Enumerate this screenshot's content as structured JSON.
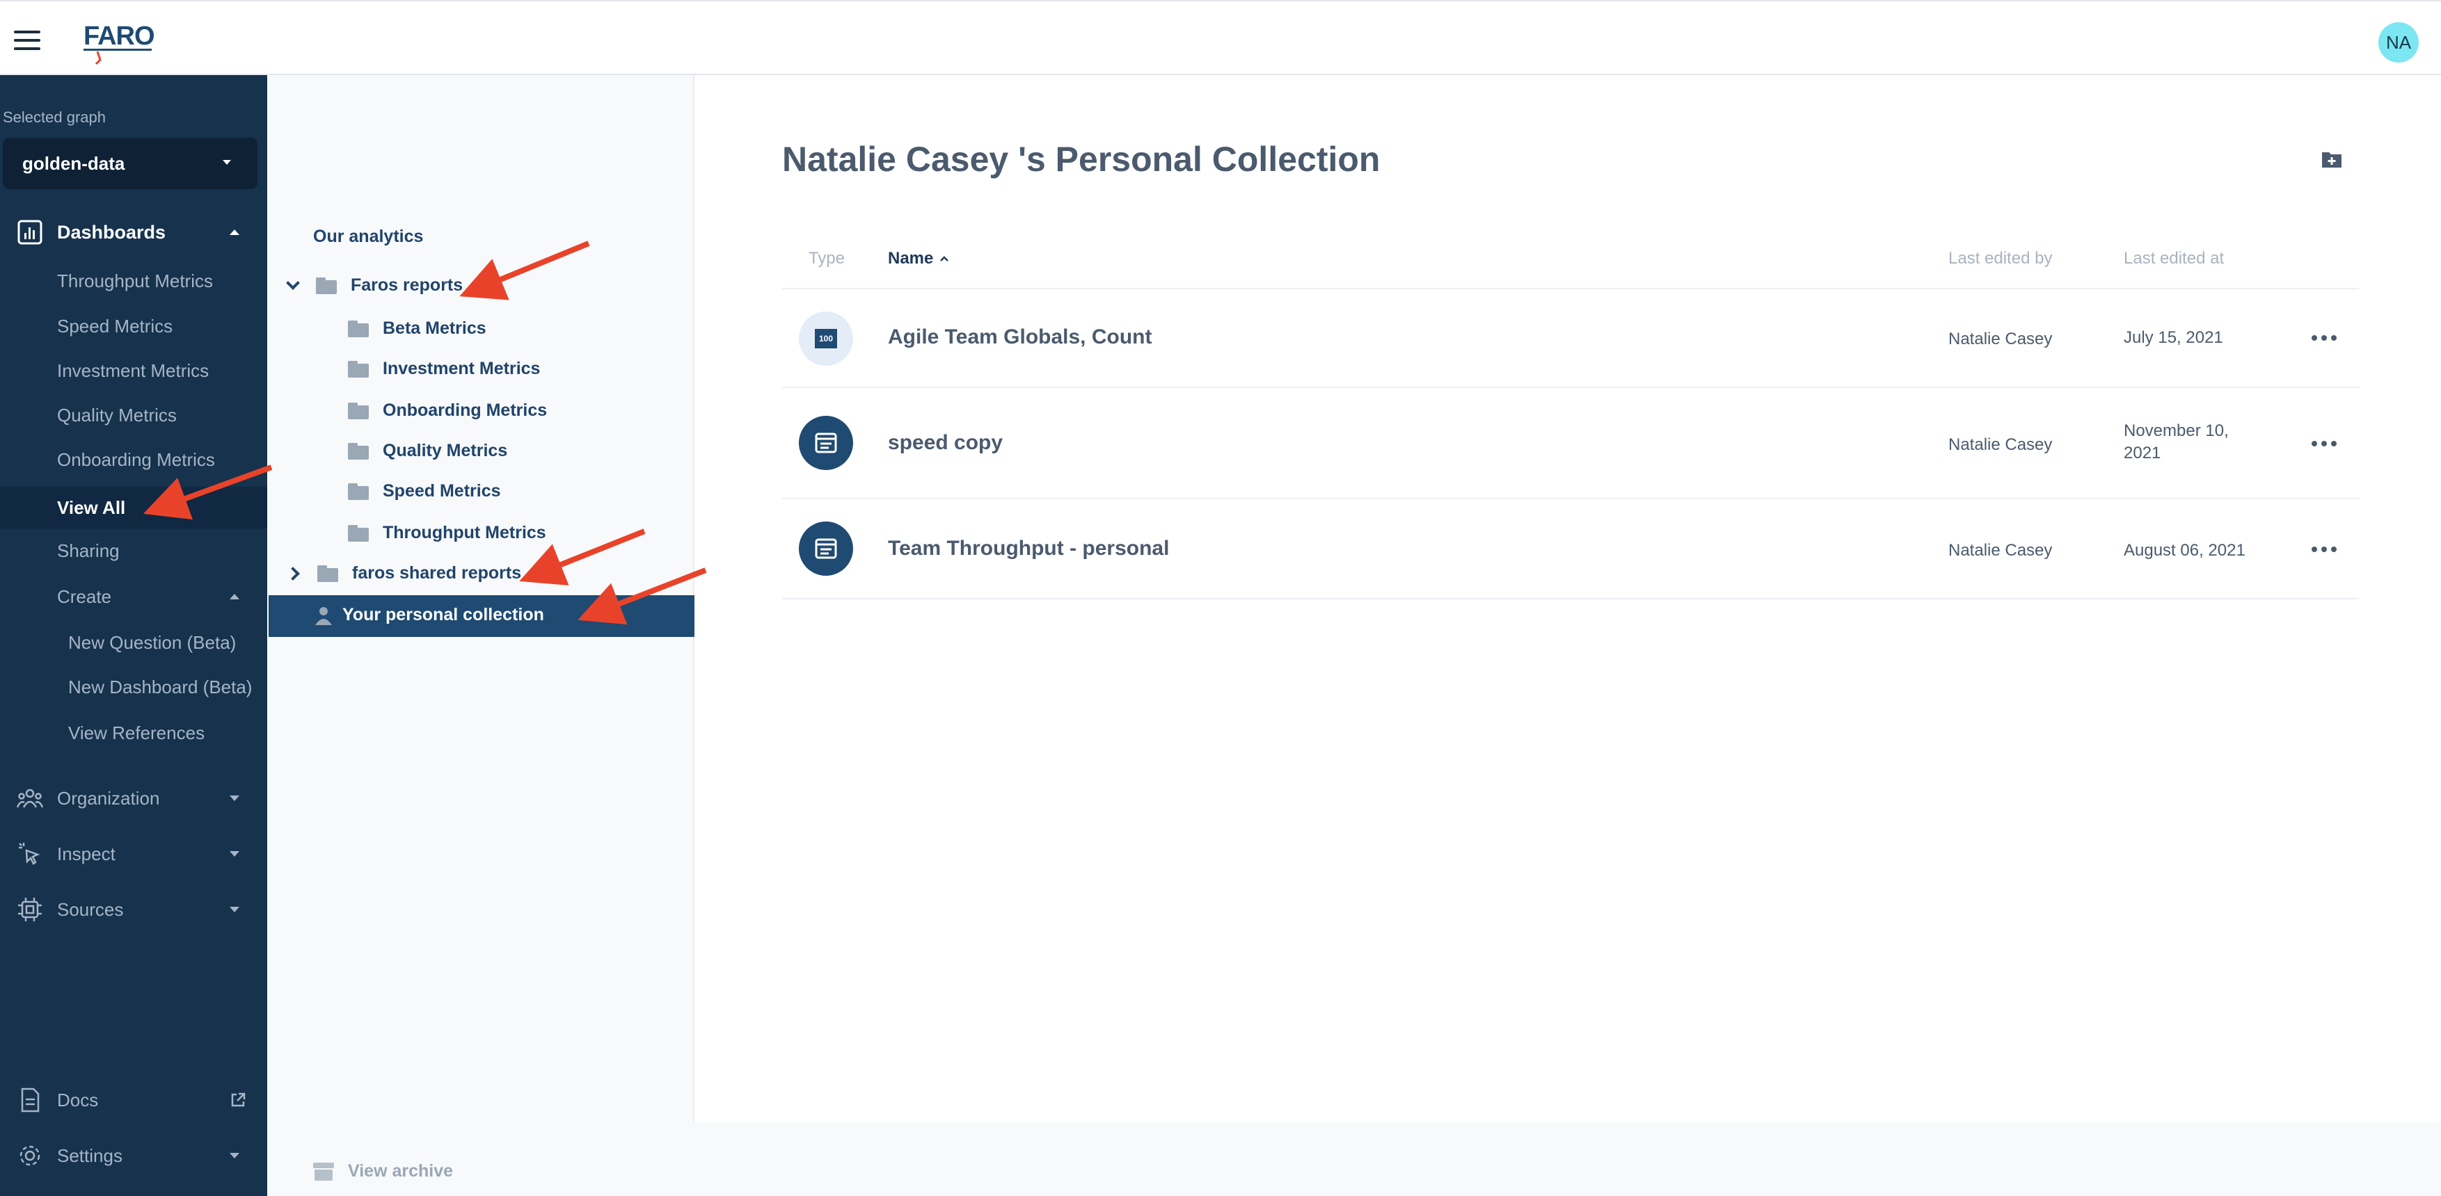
{
  "header": {
    "logo_text": "FAROS",
    "avatar_initials": "NA"
  },
  "sidebar": {
    "selected_graph_label": "Selected graph",
    "selected_graph_value": "golden-data",
    "dashboards_label": "Dashboards",
    "dashboard_items": [
      "Throughput Metrics",
      "Speed Metrics",
      "Investment Metrics",
      "Quality Metrics",
      "Onboarding Metrics"
    ],
    "view_all_label": "View All",
    "sharing_label": "Sharing",
    "create_label": "Create",
    "create_items": [
      "New Question (Beta)",
      "New Dashboard (Beta)",
      "View References"
    ],
    "organization_label": "Organization",
    "inspect_label": "Inspect",
    "sources_label": "Sources",
    "docs_label": "Docs",
    "settings_label": "Settings"
  },
  "tree": {
    "our_analytics": "Our analytics",
    "faros_reports": "Faros reports",
    "faros_reports_children": [
      "Beta Metrics",
      "Investment Metrics",
      "Onboarding Metrics",
      "Quality Metrics",
      "Speed Metrics",
      "Throughput Metrics"
    ],
    "shared_reports": "faros shared reports",
    "personal_collection": "Your personal collection",
    "view_archive": "View archive"
  },
  "main": {
    "title": "Natalie Casey 's Personal Collection",
    "columns": {
      "type": "Type",
      "name": "Name",
      "last_edited_by": "Last edited by",
      "last_edited_at": "Last edited at"
    },
    "rows": [
      {
        "icon": "scalar-100-icon",
        "icon_text": "100",
        "name": "Agile Team Globals, Count",
        "edited_by": "Natalie Casey",
        "edited_at": "July 15, 2021"
      },
      {
        "icon": "dashboard-icon",
        "name": "speed copy",
        "edited_by": "Natalie Casey",
        "edited_at": "November 10, 2021"
      },
      {
        "icon": "dashboard-icon",
        "name": "Team Throughput - personal",
        "edited_by": "Natalie Casey",
        "edited_at": "August 06, 2021"
      }
    ]
  },
  "colors": {
    "sidebar_bg": "#16324d",
    "accent_blue": "#1f4a72",
    "annotation_arrow": "#e8432a",
    "avatar_bg": "#7ce6f2"
  }
}
